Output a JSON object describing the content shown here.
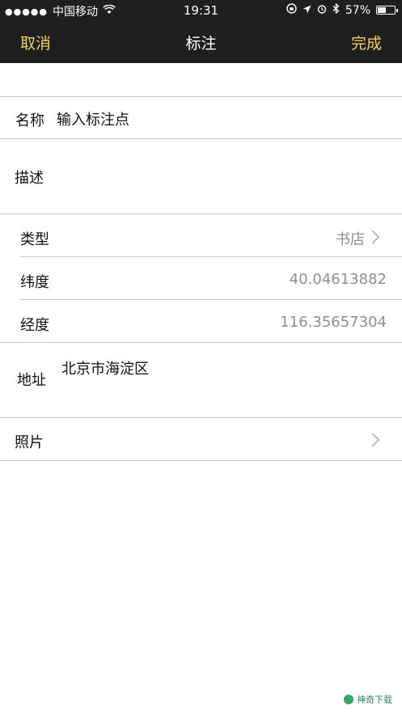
{
  "status": {
    "carrier": "中国移动",
    "time": "19:31",
    "battery": "57%",
    "battery_level": 0.57
  },
  "nav": {
    "cancel": "取消",
    "title": "标注",
    "done": "完成"
  },
  "form": {
    "name_label": "名称",
    "name_placeholder": "输入标注点",
    "desc_label": "描述",
    "type_label": "类型",
    "type_value": "书店",
    "lat_label": "纬度",
    "lat_value": "40.04613882",
    "lng_label": "经度",
    "lng_value": "116.35657304",
    "addr_label": "地址",
    "addr_value": "北京市海淀区",
    "photo_label": "照片"
  },
  "watermark": "神奇下载",
  "colors": {
    "accent": "#f0d060",
    "bar": "#1f1f1f"
  }
}
